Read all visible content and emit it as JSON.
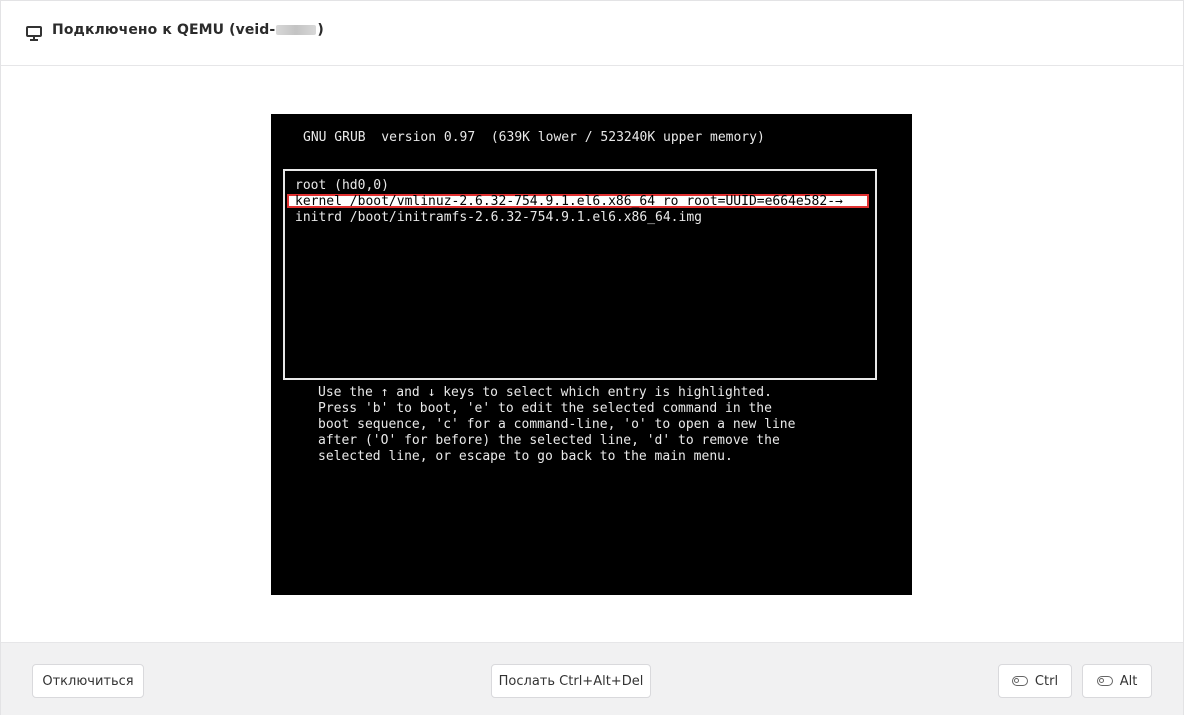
{
  "header": {
    "title_prefix": "Подключено к QEMU (veid-",
    "title_suffix": ")"
  },
  "console": {
    "grub_header": "GNU GRUB  version 0.97  (639K lower / 523240K upper memory)",
    "entries": [
      "root (hd0,0)",
      "kernel /boot/vmlinuz-2.6.32-754.9.1.el6.x86_64 ro root=UUID=e664e582-→",
      "initrd /boot/initramfs-2.6.32-754.9.1.el6.x86_64.img"
    ],
    "help_lines": [
      "Use the ↑ and ↓ keys to select which entry is highlighted.",
      "Press 'b' to boot, 'e' to edit the selected command in the",
      "boot sequence, 'c' for a command-line, 'o' to open a new line",
      "after ('O' for before) the selected line, 'd' to remove the",
      "selected line, or escape to go back to the main menu."
    ]
  },
  "footer": {
    "disconnect_label": "Отключиться",
    "send_cad_label": "Послать Ctrl+Alt+Del",
    "ctrl_label": "Ctrl",
    "alt_label": "Alt"
  },
  "colors": {
    "highlight_border": "#e03131",
    "console_bg": "#000000",
    "page_bg": "#f1f1f2"
  }
}
